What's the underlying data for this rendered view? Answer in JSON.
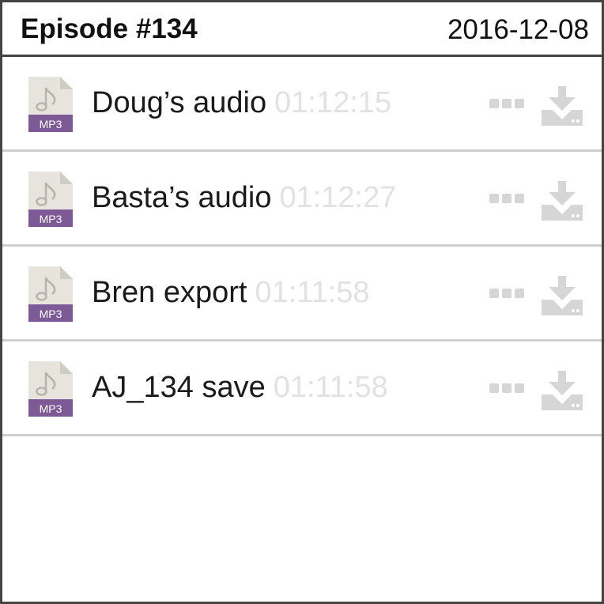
{
  "header": {
    "title": "Episode #134",
    "date": "2016-12-08"
  },
  "files": [
    {
      "name": "Doug’s audio",
      "duration": "01:12:15",
      "type": "MP3"
    },
    {
      "name": "Basta’s audio",
      "duration": "01:12:27",
      "type": "MP3"
    },
    {
      "name": "Bren export",
      "duration": "01:11:58",
      "type": "MP3"
    },
    {
      "name": "AJ_134 save",
      "duration": "01:11:58",
      "type": "MP3"
    }
  ],
  "icons": {
    "file": "mp3-file-icon",
    "more": "more-icon",
    "download": "download-icon"
  },
  "colors": {
    "badge": "#7d5a96",
    "file_body": "#e6e4dd",
    "divider": "#cfcfcf",
    "action_icon": "#d6d6d6",
    "duration": "#e2e2e2",
    "border": "#444444"
  }
}
